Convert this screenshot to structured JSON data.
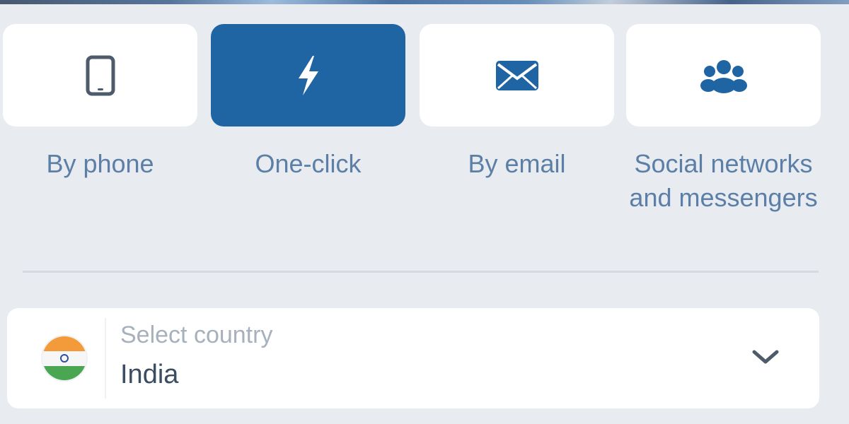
{
  "auth_methods": [
    {
      "id": "phone",
      "label": "By phone",
      "icon": "phone-icon",
      "active": false
    },
    {
      "id": "oneclick",
      "label": "One-click",
      "icon": "lightning-icon",
      "active": true
    },
    {
      "id": "email",
      "label": "By email",
      "icon": "envelope-icon",
      "active": false
    },
    {
      "id": "social",
      "label": "Social networks and messengers",
      "icon": "people-group-icon",
      "active": false
    }
  ],
  "country_select": {
    "label": "Select country",
    "value": "India",
    "flag_icon": "india-flag-icon",
    "chevron_icon": "chevron-down-icon"
  },
  "colors": {
    "accent": "#1f64a3",
    "label_text": "#5b7fa6",
    "background": "#e8ebef"
  }
}
